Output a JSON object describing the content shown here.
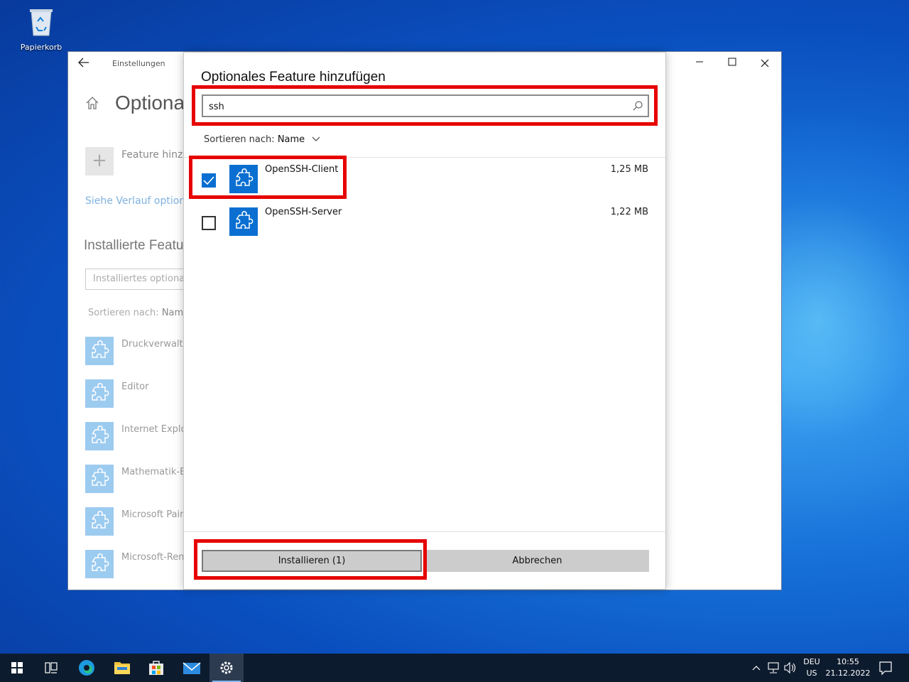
{
  "desktop": {
    "recycle_bin_label": "Papierkorb"
  },
  "settings": {
    "window_title": "Einstellungen",
    "heading": "Optiona",
    "add_feature_label": "Feature hinzuf",
    "history_link": "Siehe Verlauf optionale",
    "installed_heading": "Installierte Featu",
    "installed_search_placeholder": "Installiertes optional",
    "sort_label": "Sortieren nach:",
    "sort_value": "Name",
    "installed_items": [
      "Druckverwaltu",
      "Editor",
      "Internet Explor",
      "Mathematik-Er",
      "Microsoft Pain",
      "Microsoft-Rem"
    ]
  },
  "dialog": {
    "title": "Optionales Feature hinzufügen",
    "search_value": "ssh",
    "sort_label": "Sortieren nach:",
    "sort_value": "Name",
    "features": [
      {
        "name": "OpenSSH-Client",
        "size": "1,25 MB",
        "checked": true
      },
      {
        "name": "OpenSSH-Server",
        "size": "1,22 MB",
        "checked": false
      }
    ],
    "install_label": "Installieren (1)",
    "cancel_label": "Abbrechen"
  },
  "taskbar": {
    "lang_top": "DEU",
    "lang_bottom": "US",
    "time": "10:55",
    "date": "21.12.2022"
  },
  "colors": {
    "accent": "#0a6fd1",
    "highlight": "#e60000",
    "taskbar": "#0d1b2e"
  }
}
